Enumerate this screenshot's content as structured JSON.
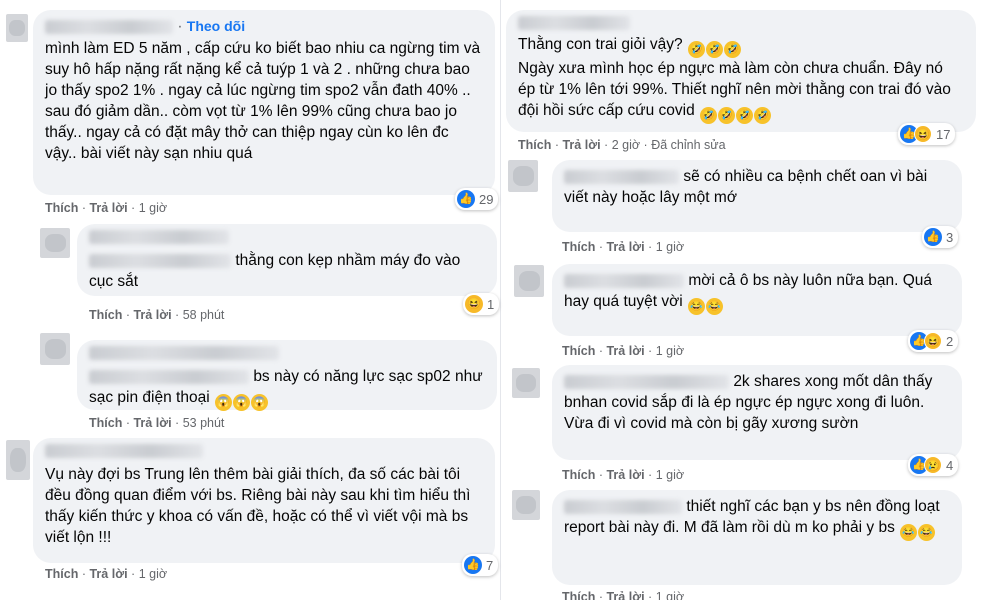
{
  "actions": {
    "like": "Thích",
    "reply": "Trả lời",
    "sep": "·"
  },
  "left": [
    {
      "follow": "Theo dõi",
      "text": "mình làm ED 5 năm , cấp cứu ko biết bao nhiu ca ngừng tim và suy hô hấp nặng rất nặng kể cả tuýp 1 và 2 . những chưa bao jo thấy spo2 1% . ngay cả lúc ngừng tim spo2 vẫn đath 40% .. sau đó giảm dần.. còm vọt từ 1% lên 99% cũng chưa bao jo thấy.. ngay cả có đặt mây thở can thiệp ngay cùn ko lên đc vậy.. bài viết này sạn nhiu quá",
      "time": "1 giờ",
      "reactions": "29"
    },
    {
      "text": "thằng con kẹp nhầm máy đo vào cục sắt",
      "time": "58 phút",
      "reactions": "1"
    },
    {
      "text": "bs này có năng lực sạc sp02 như sạc pin điện thoại",
      "time": "53 phút"
    },
    {
      "text": "Vụ này đợi bs Trung lên thêm bài giải thích, đa số các bài tôi đều đồng quan điểm với bs. Riêng bài này sau khi tìm hiểu thì thấy kiến thức y khoa có vấn đề, hoặc có thể vì viết vội mà bs viết lộn !!!",
      "time": "1 giờ",
      "reactions": "7"
    }
  ],
  "right": [
    {
      "line1": "Thằng con trai giỏi vậy?",
      "text": "Ngày xưa mình học ép ngực mà làm còn chưa chuẩn. Đây nó ép từ 1% lên tới 99%. Thiết nghĩ nên mời thằng con trai đó vào đội hồi sức cấp cứu covid",
      "time": "2 giờ",
      "edited": "Đã chỉnh sửa",
      "reactions": "17"
    },
    {
      "text": "sẽ có nhiều ca bệnh chết oan vì bài viết này hoặc lây một mớ",
      "time": "1 giờ",
      "reactions": "3"
    },
    {
      "text": "mời cả ô bs này luôn nữa bạn. Quá hay quá tuyệt vời",
      "time": "1 giờ",
      "reactions": "2"
    },
    {
      "text": "2k shares xong mốt dân thấy bnhan covid sắp đi là ép ngực ép ngực xong đi luôn. Vừa đi vì covid mà còn bị gãy xương sườn",
      "time": "1 giờ",
      "reactions": "4"
    },
    {
      "text": "thiết nghĩ các bạn y bs nên đồng loạt report bài này đi. M đã làm rồi dù m ko phải y bs",
      "time": "1 giờ"
    }
  ],
  "icons": {
    "like": "like-icon",
    "haha": "haha-icon",
    "wow": "wow-icon",
    "sad": "sad-icon"
  },
  "colors": {
    "bubble": "#f0f2f5",
    "link": "#1877f2",
    "meta": "#65676b",
    "like": "#1877f2"
  }
}
